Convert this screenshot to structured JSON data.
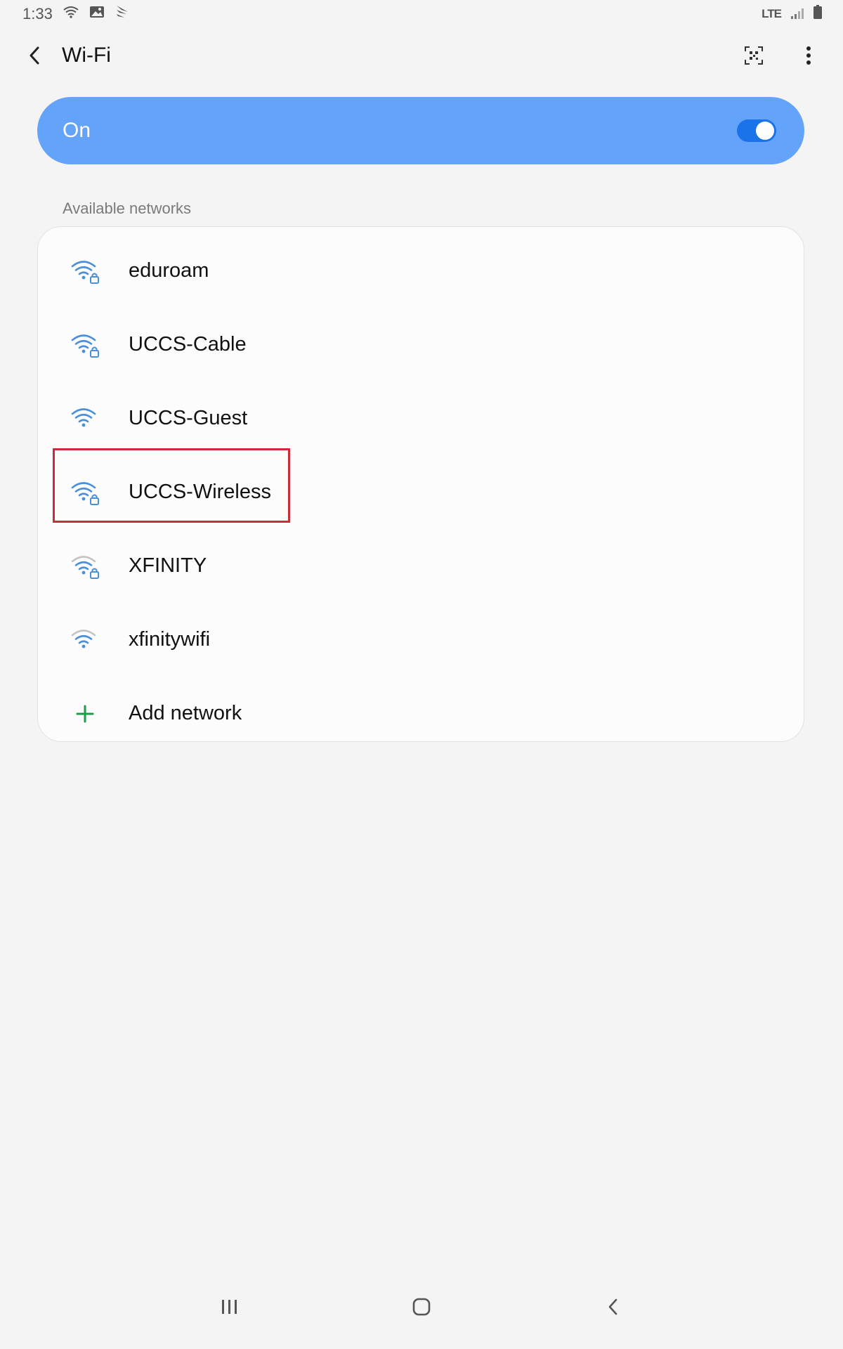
{
  "status_bar": {
    "time": "1:33",
    "network_type": "LTE",
    "icons": [
      "wifi-icon",
      "image-icon",
      "sprint-icon",
      "signal-icon",
      "battery-icon"
    ]
  },
  "app_bar": {
    "title": "Wi-Fi",
    "actions": [
      "qr-code-scan-icon",
      "more-options-icon"
    ]
  },
  "master_switch": {
    "label": "On",
    "checked": true
  },
  "networks_section": {
    "header": "Available networks",
    "networks": [
      {
        "ssid": "eduroam",
        "secured": true,
        "signal": "strong"
      },
      {
        "ssid": "UCCS-Cable",
        "secured": true,
        "signal": "strong"
      },
      {
        "ssid": "UCCS-Guest",
        "secured": false,
        "signal": "strong"
      },
      {
        "ssid": "UCCS-Wireless",
        "secured": true,
        "signal": "strong",
        "highlighted": true
      },
      {
        "ssid": "XFINITY",
        "secured": true,
        "signal": "weak"
      },
      {
        "ssid": "xfinitywifi",
        "secured": false,
        "signal": "weak"
      }
    ],
    "add_network_label": "Add network"
  },
  "colors": {
    "accent": "#63a4fa",
    "toggle": "#1a73e8",
    "wifi_strong": "#4a8fd9",
    "wifi_weak": "#a9a9a9",
    "add_icon": "#1a9c4a",
    "highlight": "#cc2a36"
  },
  "nav_bar": {
    "buttons": [
      "recent-apps-icon",
      "home-icon",
      "back-icon"
    ]
  }
}
